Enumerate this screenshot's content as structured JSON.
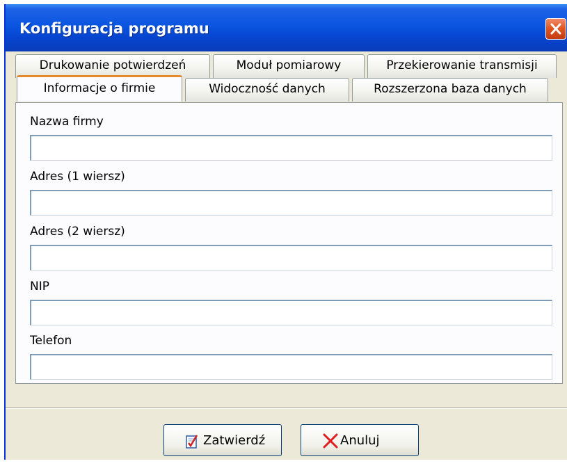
{
  "window": {
    "title": "Konfiguracja programu"
  },
  "tabs": {
    "row_back": [
      "Drukowanie potwierdzeń",
      "Moduł pomiarowy",
      "Przekierowanie transmisji"
    ],
    "row_front": [
      "Informacje o firmie",
      "Widoczność danych",
      "Rozszerzona baza danych"
    ],
    "active": "Informacje o firmie"
  },
  "fields": [
    {
      "label": "Nazwa firmy",
      "value": ""
    },
    {
      "label": "Adres (1 wiersz)",
      "value": ""
    },
    {
      "label": "Adres (2 wiersz)",
      "value": ""
    },
    {
      "label": "NIP",
      "value": ""
    },
    {
      "label": "Telefon",
      "value": ""
    }
  ],
  "buttons": {
    "ok": {
      "label": "Zatwierdź",
      "icon": "checklist-icon"
    },
    "cancel": {
      "label": "Anuluj",
      "icon": "x-icon"
    }
  },
  "colors": {
    "titlebar": "#0a55e0",
    "close": "#e0541f",
    "active_tab_accent": "#e68b2c",
    "cancel_x": "#e02020"
  }
}
